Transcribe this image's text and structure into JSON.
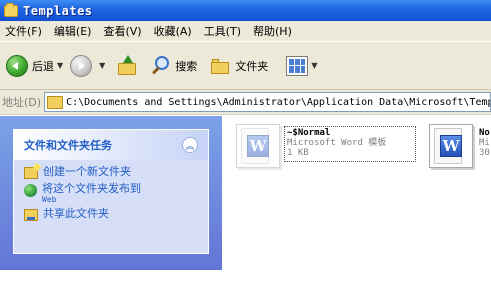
{
  "window": {
    "title": "Templates"
  },
  "menu": [
    "文件(F)",
    "编辑(E)",
    "查看(V)",
    "收藏(A)",
    "工具(T)",
    "帮助(H)"
  ],
  "toolbar": {
    "back_label": "后退",
    "search_label": "搜索",
    "folders_label": "文件夹"
  },
  "address": {
    "label": "地址(D)",
    "path": "C:\\Documents and Settings\\Administrator\\Application Data\\Microsoft\\Templates"
  },
  "task_pane": {
    "header": "文件和文件夹任务",
    "items": [
      {
        "label": "创建一个新文件夹",
        "sublabel": ""
      },
      {
        "label": "将这个文件夹发布到",
        "sublabel": "Web"
      },
      {
        "label": "共享此文件夹",
        "sublabel": ""
      }
    ]
  },
  "files": [
    {
      "name": "~$Normal",
      "type": "Microsoft Word 模板",
      "size": "1 KB"
    },
    {
      "name": "No",
      "type": "Mi",
      "size": "30"
    }
  ]
}
